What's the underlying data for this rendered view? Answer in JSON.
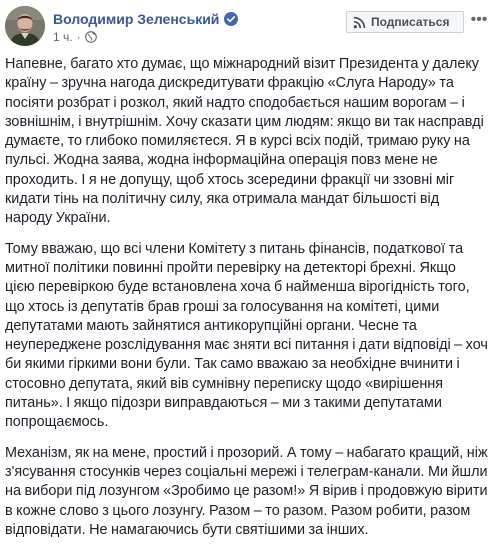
{
  "post": {
    "author_name": "Володимир Зеленський",
    "timestamp": "1 ч.",
    "meta_separator": "·",
    "subscribe_label": "Подписаться",
    "more_icon_text": "•••",
    "paragraphs": [
      "Напевне, багато хто думає, що міжнародний візит Президента у далеку країну – зручна нагода дискредитувати фракцію «Слуга Народу» та посіяти розбрат і розкол, який надто сподобається нашим ворогам – і зовнішнім, і внутрішнім. Хочу сказати цим людям: якщо ви так насправді думаєте, то глибоко помиляєтеся. Я в курсі всіх подій, тримаю руку на пульсі. Жодна заява, жодна інформаційна операція повз мене не проходить. І я не допущу, щоб хтось зсередини фракції чи ззовні міг кидати тінь на політичну силу, яка отримала мандат більшості від народу України.",
      "Тому вважаю, що всі члени Комітету з питань фінансів, податкової та митної політики повинні пройти перевірку на детекторі брехні. Якщо цією перевіркою буде встановлена хоча б найменша вірогідність того, що хтось із депутатів брав гроші за голосування на комітеті, цими депутатами мають зайнятися антикорупційні органи. Чесне та неупереджене розслідування має зняти всі питання і дати відповіді – хоч би якими гіркими вони були. Так само вважаю за необхідне вчинити і стосовно депутата, який вів сумнівну переписку щодо «вирішення питань». І якщо підозри виправдаються – ми з такими депутатами попрощаємось.",
      "Механізм, як на мене, простий і прозорий. А тому – набагато кращий, ніж з'ясування стосунків через соціальні мережі і телеграм-канали. Ми йшли на вибори під лозунгом «Зробимо це разом!» Я вірив і продовжую вірити в кожне слово з цього лозунгу. Разом – то разом. Разом робити, разом відповідати. Не намагаючись бути святішими за інших."
    ]
  },
  "colors": {
    "author_link": "#385898",
    "verified_badge": "#4267b2",
    "body_text": "#1d2129",
    "meta_text": "#616770"
  },
  "icons": {
    "avatar": "author-avatar-photo",
    "verified": "verified-badge-icon",
    "privacy": "globe-icon",
    "subscribe": "rss-icon",
    "more": "more-options-icon"
  }
}
